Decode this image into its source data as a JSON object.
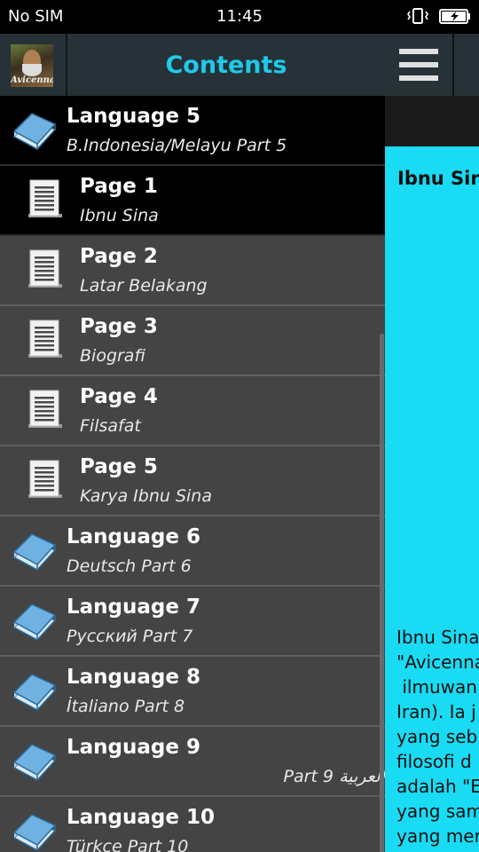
{
  "status_bar": {
    "carrier": "No SIM",
    "time": "11:45"
  },
  "drawer": {
    "title": "Contents",
    "avatar_text": "Avicenna",
    "items": [
      {
        "type": "language",
        "title": "Language 5",
        "subtitle": "B.Indonesia/Melayu Part 5",
        "active": true
      },
      {
        "type": "page",
        "title": "Page 1",
        "subtitle": "Ibnu Sina",
        "active": true
      },
      {
        "type": "page",
        "title": "Page 2",
        "subtitle": "Latar Belakang"
      },
      {
        "type": "page",
        "title": "Page 3",
        "subtitle": "Biografi"
      },
      {
        "type": "page",
        "title": "Page 4",
        "subtitle": "Filsafat"
      },
      {
        "type": "page",
        "title": "Page 5",
        "subtitle": "Karya Ibnu Sina"
      },
      {
        "type": "language",
        "title": "Language 6",
        "subtitle": "Deutsch Part 6"
      },
      {
        "type": "language",
        "title": "Language 7",
        "subtitle": "Русский Part 7"
      },
      {
        "type": "language",
        "title": "Language 8",
        "subtitle": "İtaliano Part 8"
      },
      {
        "type": "language",
        "title": "Language 9",
        "subtitle": "العربية Part 9"
      },
      {
        "type": "language",
        "title": "Language 10",
        "subtitle": "Türkçe Part 10"
      }
    ]
  },
  "content": {
    "title": "Ibnu Sina",
    "paragraph": "Ibnu Sina\n\"Avicenna\n ilmuwan \nIran). Ia j\nyang seb\nfilosofi d\nadalah \"E\nyang sam\nyang mer"
  },
  "colors": {
    "accent": "#20c9ea",
    "content_background": "#19dbf4",
    "header_background": "#263238",
    "drawer_background": "#444444"
  },
  "icons": {
    "menu": "hamburger-menu-icon",
    "language": "book-icon",
    "page": "document-icon"
  }
}
